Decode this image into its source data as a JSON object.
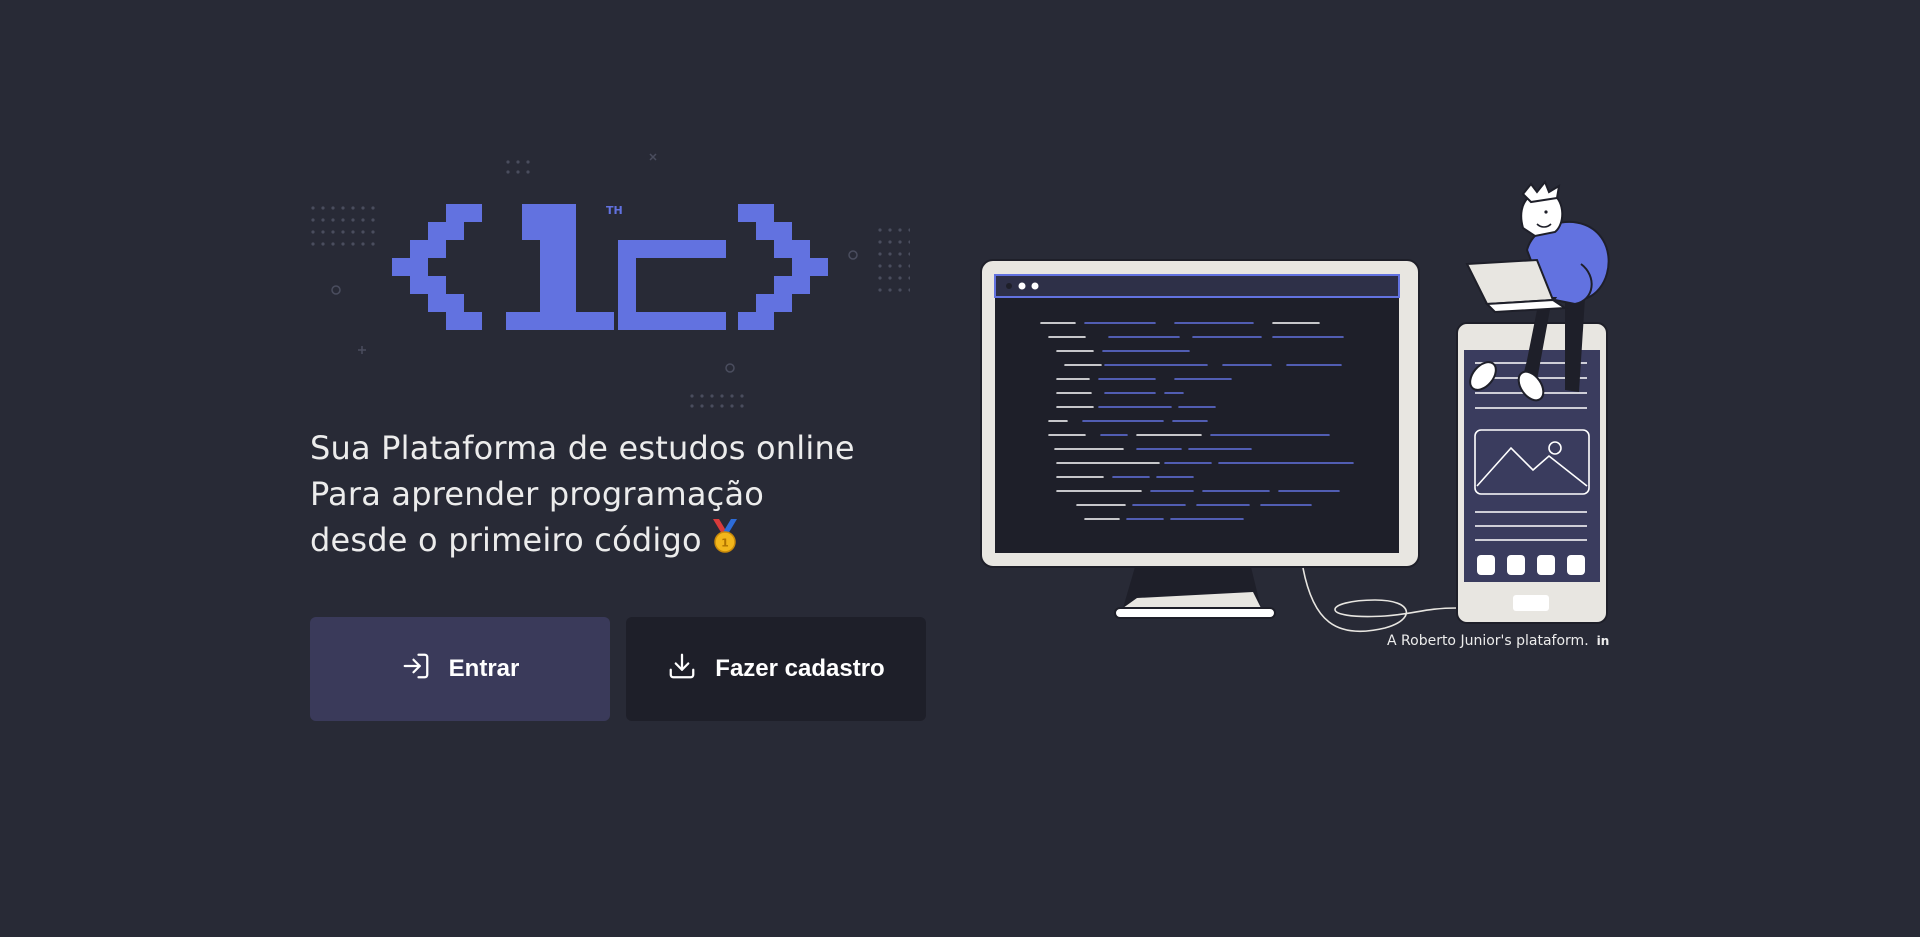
{
  "logo": {
    "trademark": "TH",
    "alt": "1c logo"
  },
  "tagline": {
    "line1": "Sua Plataforma de estudos online",
    "line2": "Para aprender programação",
    "line3": "desde o primeiro código"
  },
  "buttons": {
    "login_label": "Entrar",
    "signup_label": "Fazer cadastro"
  },
  "illustration": {
    "credit": "A Roberto Junior's plataform.",
    "credit_link": "in"
  },
  "colors": {
    "background": "#282a36",
    "accent": "#6272e0",
    "primary_button": "#3a3a5a",
    "secondary_button": "#1e1f29"
  },
  "icons": {
    "login": "login-arrow-icon",
    "download": "download-icon",
    "medal": "medal-icon"
  }
}
